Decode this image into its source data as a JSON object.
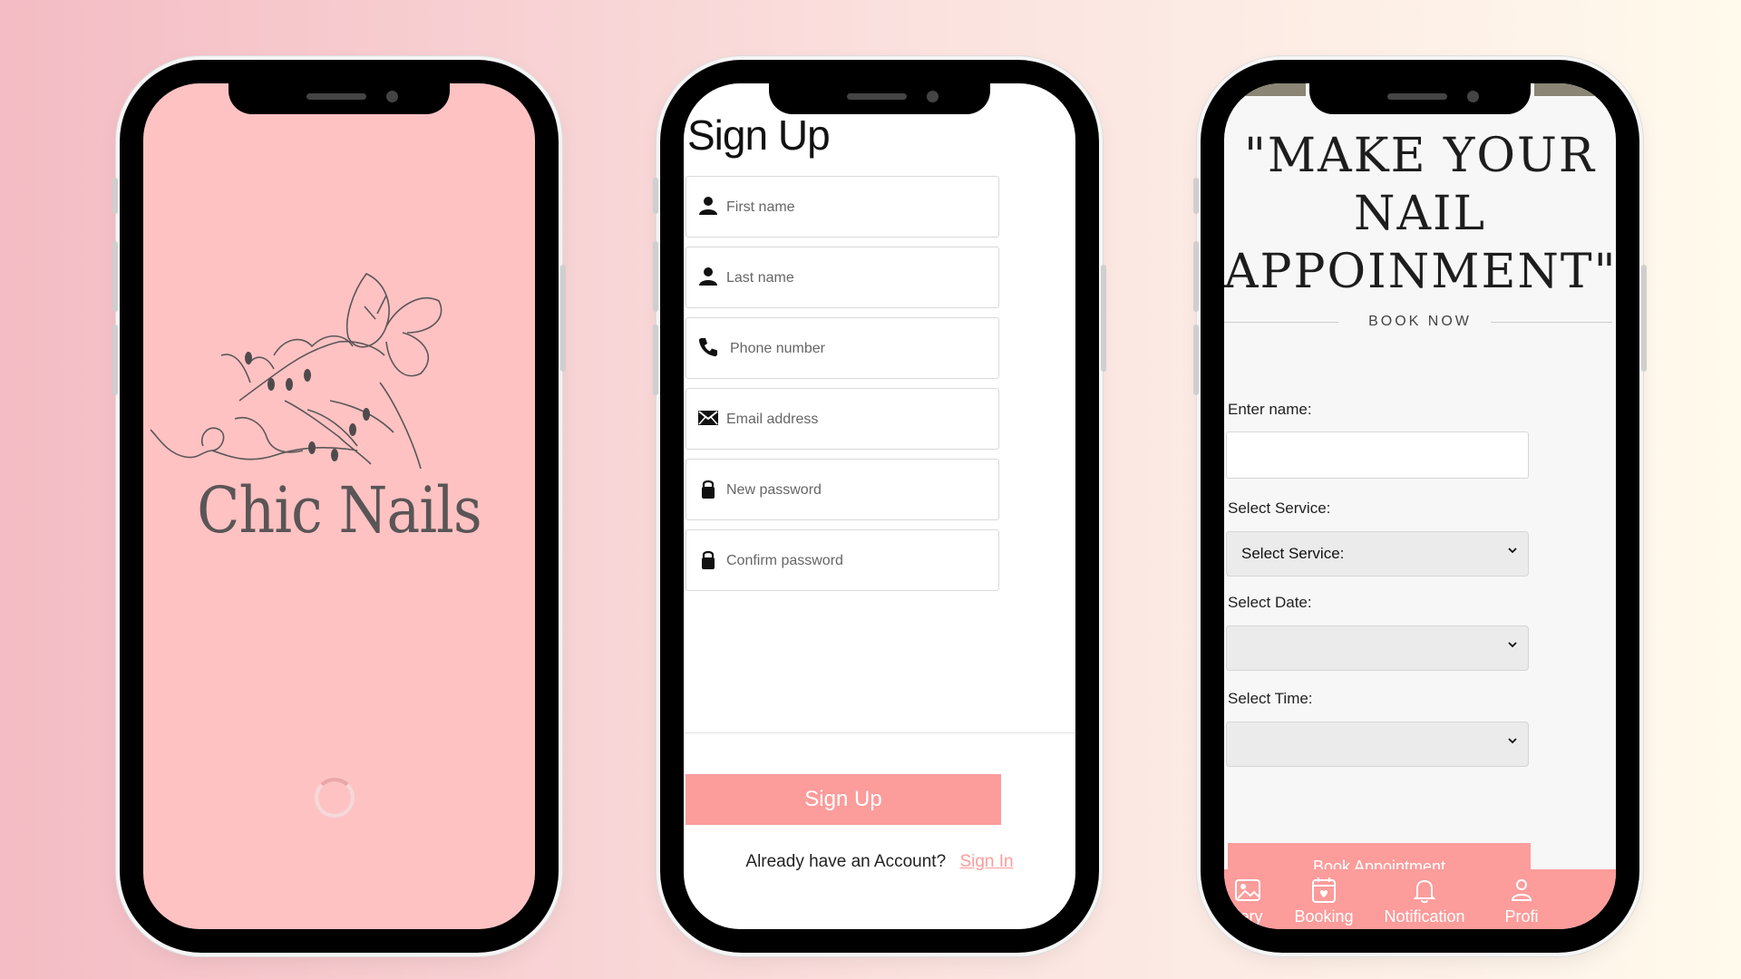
{
  "phone1": {
    "logo_text": "Chic Nails"
  },
  "phone2": {
    "title": "Sign Up",
    "fields": [
      {
        "placeholder": "First name",
        "icon": "person-icon"
      },
      {
        "placeholder": "Last name",
        "icon": "person-icon"
      },
      {
        "placeholder": "Phone number",
        "icon": "phone-icon"
      },
      {
        "placeholder": "Email address",
        "icon": "envelope-icon"
      },
      {
        "placeholder": "New password",
        "icon": "lock-icon"
      },
      {
        "placeholder": "Confirm password",
        "icon": "lock-icon"
      }
    ],
    "button": "Sign Up",
    "signin_prompt": "Already have an Account?",
    "signin_link": "Sign In"
  },
  "phone3": {
    "headline_lines": [
      "\"MAKE YOUR",
      "NAIL",
      "APPOINMENT\""
    ],
    "book_now": "BOOK NOW",
    "name_label": "Enter name:",
    "service_label": "Select Service:",
    "service_value": "Select Service:",
    "date_label": "Select Date:",
    "time_label": "Select Time:",
    "book_button": "Book Appointment",
    "tabs": [
      {
        "label": "llery",
        "icon": "gallery-icon"
      },
      {
        "label": "Booking",
        "icon": "booking-icon"
      },
      {
        "label": "Notification",
        "icon": "bell-icon"
      },
      {
        "label": "Profi",
        "icon": "profile-icon"
      }
    ]
  },
  "colors": {
    "accent": "#fc9c9b",
    "splash_bg": "#ffc2c3"
  }
}
